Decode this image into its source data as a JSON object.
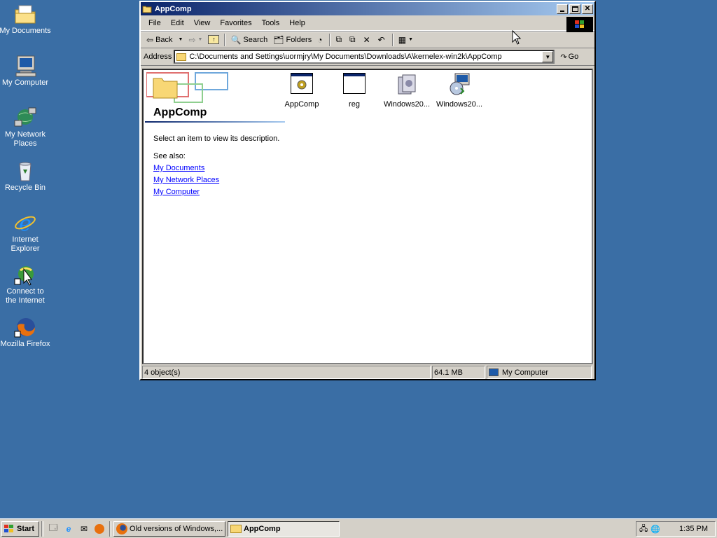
{
  "desktop": {
    "icons": [
      {
        "label": "My Documents"
      },
      {
        "label": "My Computer"
      },
      {
        "label": "My Network Places"
      },
      {
        "label": "Recycle Bin"
      },
      {
        "label": "Internet Explorer"
      },
      {
        "label": "Connect to the Internet"
      },
      {
        "label": "Mozilla Firefox"
      }
    ]
  },
  "window": {
    "title": "AppComp",
    "menu": [
      "File",
      "Edit",
      "View",
      "Favorites",
      "Tools",
      "Help"
    ],
    "toolbar": {
      "back": "Back",
      "search": "Search",
      "folders": "Folders"
    },
    "address": {
      "label": "Address",
      "path": "C:\\Documents and Settings\\uormjry\\My Documents\\Downloads\\A\\kernelex-win2k\\AppComp",
      "go": "Go"
    },
    "webview": {
      "title": "AppComp",
      "description": "Select an item to view its description.",
      "see_also": "See also:",
      "links": [
        "My Documents",
        "My Network Places",
        "My Computer"
      ]
    },
    "files": [
      {
        "name": "AppComp",
        "icon": "gear-app-icon"
      },
      {
        "name": "reg",
        "icon": "window-app-icon"
      },
      {
        "name": "Windows20...",
        "icon": "installer-icon"
      },
      {
        "name": "Windows20...",
        "icon": "setup-disc-icon"
      }
    ],
    "status": {
      "objects": "4 object(s)",
      "size": "64.1 MB",
      "zone": "My Computer"
    }
  },
  "taskbar": {
    "start": "Start",
    "tasks": [
      {
        "label": "Old versions of Windows,...",
        "active": false
      },
      {
        "label": "AppComp",
        "active": true
      }
    ],
    "clock": "1:35 PM"
  },
  "colors": {
    "desktop": "#3a6ea5",
    "titlebar_start": "#0a246a",
    "titlebar_end": "#a6caf0",
    "chrome": "#d4d0c8"
  }
}
